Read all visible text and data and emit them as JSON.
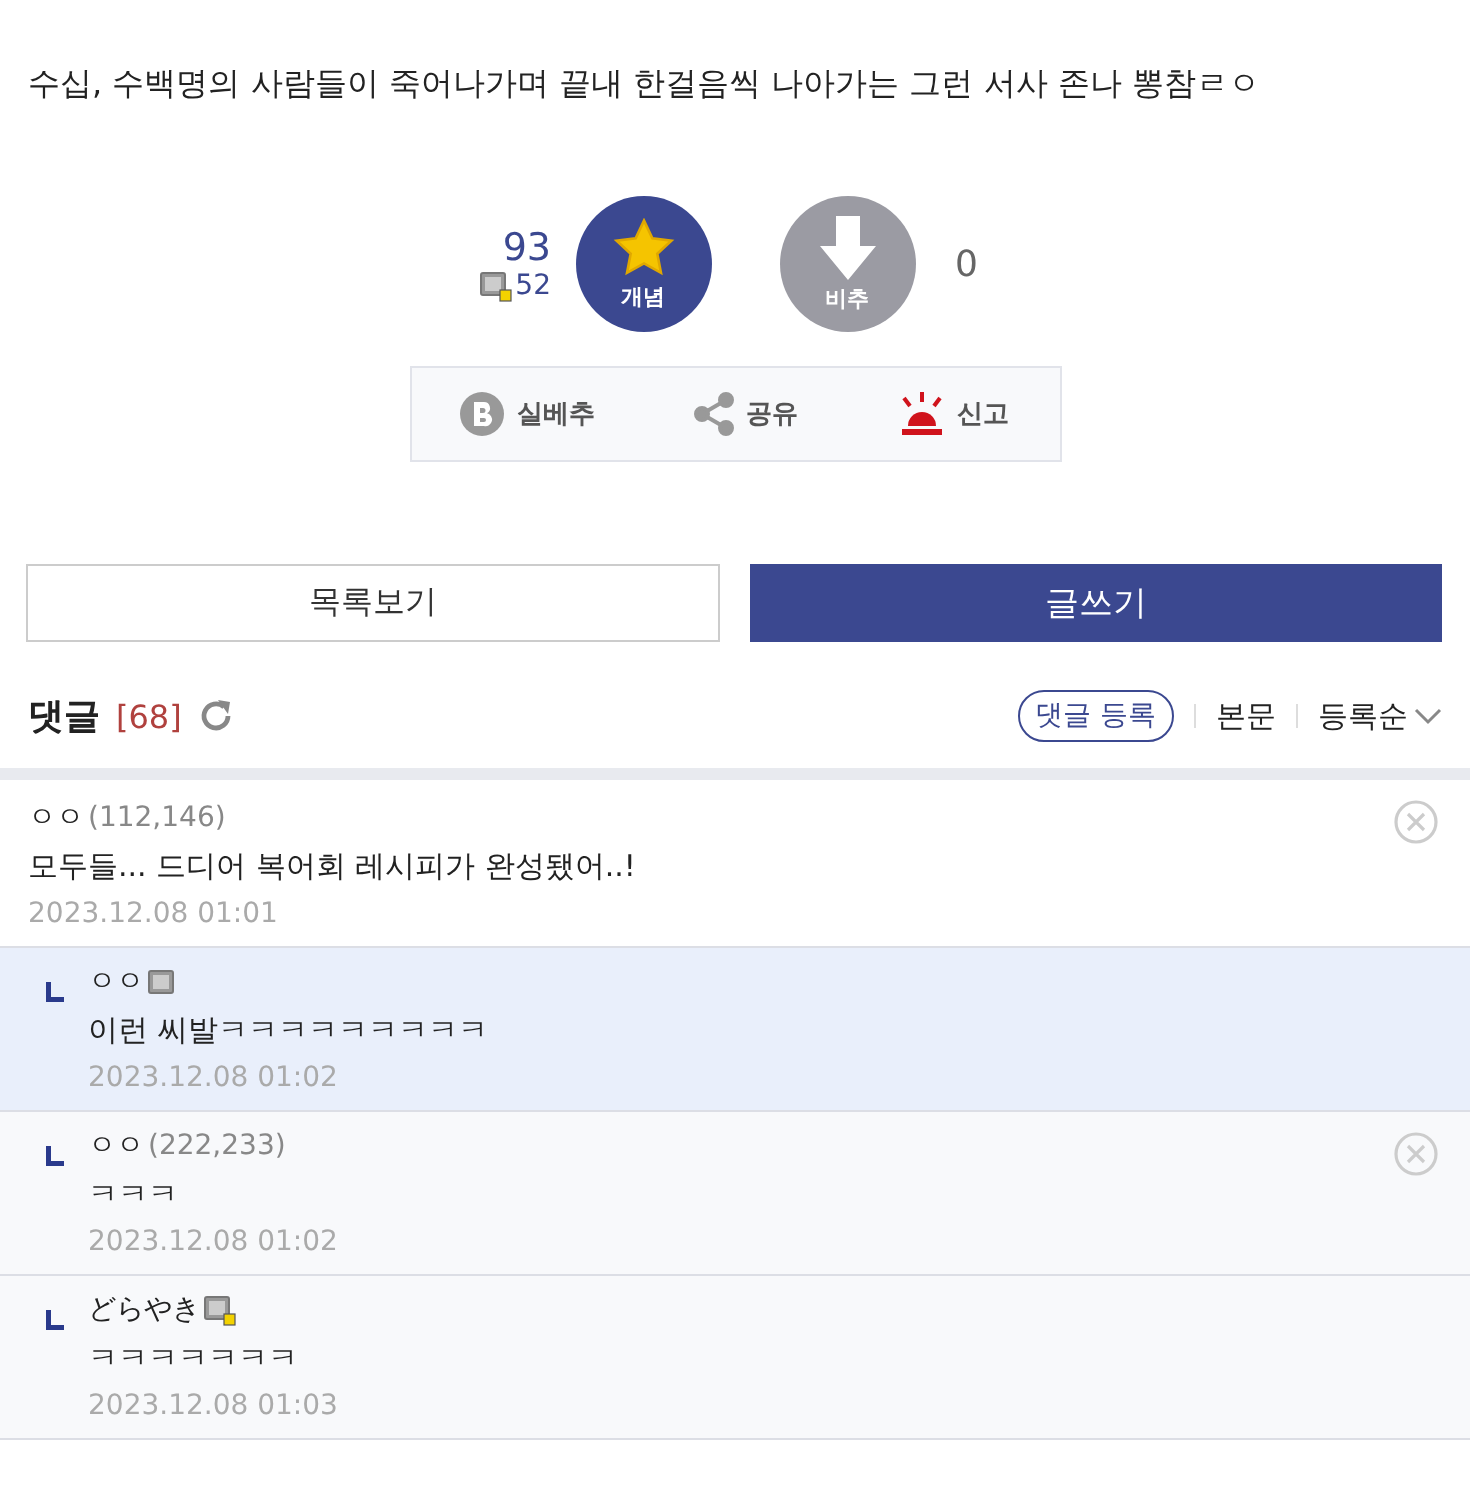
{
  "post_text": "수십, 수백명의 사람들이 죽어나가며 끝내 한걸음씩 나아가는 그런 서사 존나 뽕참ㄹㅇ",
  "vote": {
    "up_count": "93",
    "fixed_count": "52",
    "up_label": "개념",
    "down_label": "비추",
    "down_count": "0"
  },
  "actions": [
    {
      "kind": "best",
      "label": "실베추"
    },
    {
      "kind": "share",
      "label": "공유"
    },
    {
      "kind": "report",
      "label": "신고"
    }
  ],
  "buttons": {
    "list": "목록보기",
    "write": "글쓰기"
  },
  "comments_header": {
    "title": "댓글",
    "count": "[68]",
    "register": "댓글 등록",
    "body": "본문",
    "sort": "등록순"
  },
  "comments": [
    {
      "nick": "ㅇㅇ",
      "ip": "(112,146)",
      "nick_icon": false,
      "text": "모두들... 드디어 복어회 레시피가 완성됐어..!",
      "date": "2023.12.08 01:01",
      "deletable": true,
      "children": [
        {
          "nick": "ㅇㅇ",
          "nick_icon": true,
          "fixed_nick": false,
          "text": "이런 씨발ㅋㅋㅋㅋㅋㅋㅋㅋㅋ",
          "date": "2023.12.08 01:02",
          "highlighted": true,
          "deletable": false
        },
        {
          "nick": "ㅇㅇ",
          "ip": "(222,233)",
          "nick_icon": false,
          "text": "ㅋㅋㅋ",
          "date": "2023.12.08 01:02",
          "highlighted": false,
          "deletable": true
        },
        {
          "nick": "どらやき",
          "nick_icon": true,
          "fixed_nick": true,
          "text": "ㅋㅋㅋㅋㅋㅋㅋ",
          "date": "2023.12.08 01:03",
          "highlighted": false,
          "deletable": false
        }
      ]
    }
  ]
}
